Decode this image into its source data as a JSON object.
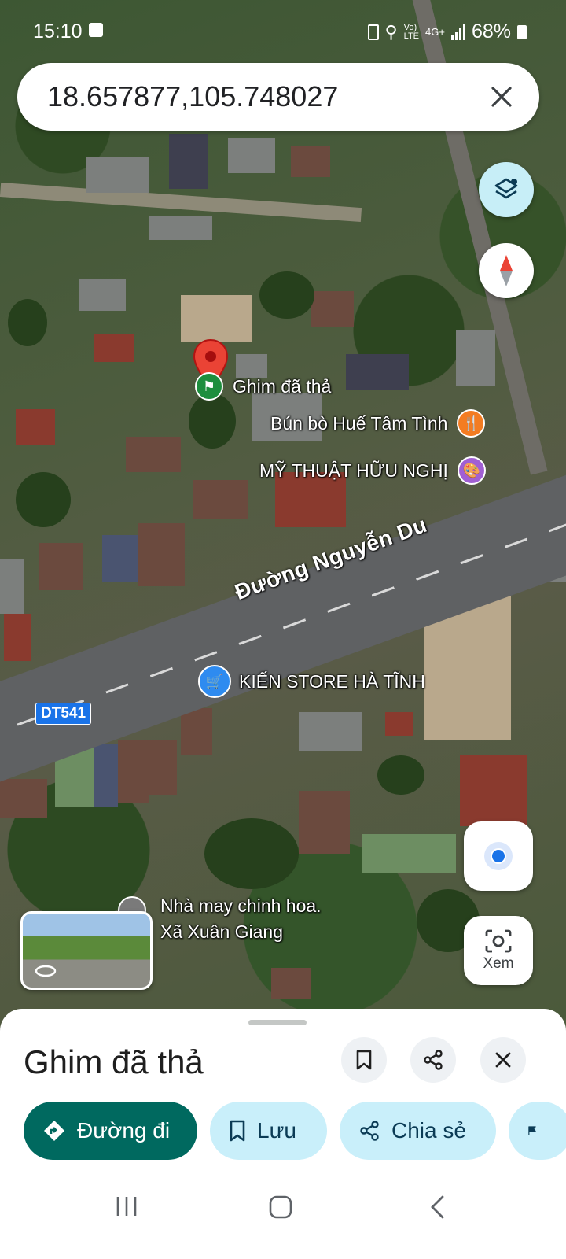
{
  "status_bar": {
    "time": "15:10",
    "battery": "68%",
    "network": "4G+"
  },
  "search": {
    "query": "18.657877,105.748027"
  },
  "map": {
    "pin_label": "Ghim đã thả",
    "places": [
      {
        "name": "Bún bò Huế Tâm Tình",
        "icon": "restaurant-icon",
        "color": "#f37c22"
      },
      {
        "name": "MỸ THUẬT HỮU NGHỊ",
        "icon": "palette-icon",
        "color": "#a15fd3"
      },
      {
        "name": "KIẾN STORE HÀ TĨNH",
        "icon": "shopping-cart-icon",
        "color": "#2e8bf0"
      },
      {
        "name": "Nhà may chinh hoa.\nXã Xuân Giang",
        "icon": "pin-icon",
        "color": "#7a7a7a"
      }
    ],
    "road_name": "Đường Nguyễn Du",
    "route_badge": "DT541",
    "lens_label": "Xem"
  },
  "sheet": {
    "title": "Ghim đã thả",
    "actions": {
      "directions": "Đường đi",
      "save": "Lưu",
      "share": "Chia sẻ"
    }
  }
}
